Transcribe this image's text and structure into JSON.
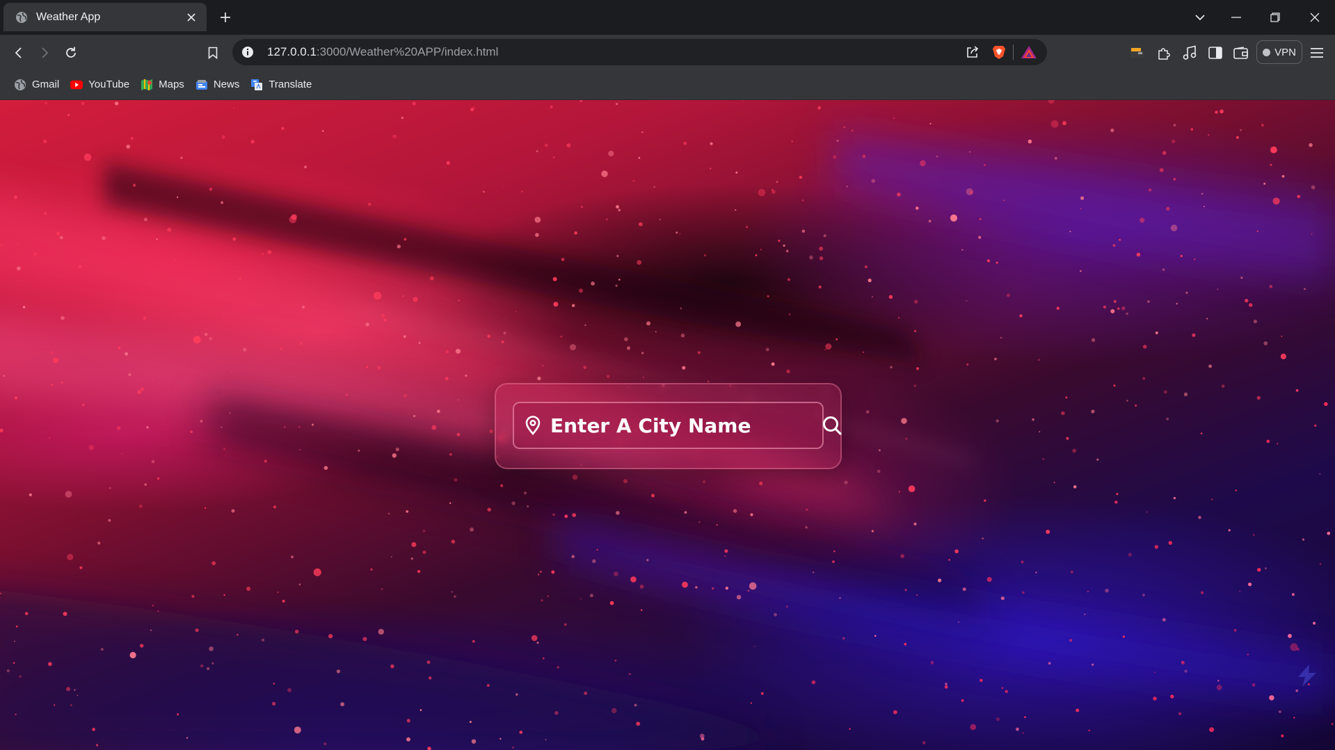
{
  "browser": {
    "tab": {
      "title": "Weather App"
    },
    "address": {
      "host": "127.0.0.1",
      "path": ":3000/Weather%20APP/index.html"
    },
    "vpn_label": "VPN",
    "bookmarks": [
      {
        "label": "Gmail",
        "icon": "globe-icon"
      },
      {
        "label": "YouTube",
        "icon": "youtube-icon"
      },
      {
        "label": "Maps",
        "icon": "maps-icon"
      },
      {
        "label": "News",
        "icon": "news-icon"
      },
      {
        "label": "Translate",
        "icon": "translate-icon"
      }
    ]
  },
  "page": {
    "search": {
      "placeholder": "Enter A City Name",
      "value": ""
    },
    "colors": {
      "accent": "#e0306a",
      "background_top": "#d31d3c",
      "background_bottom": "#140634"
    }
  }
}
